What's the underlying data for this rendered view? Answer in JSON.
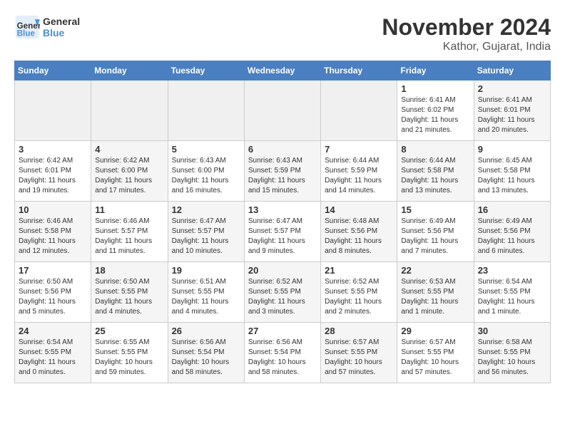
{
  "header": {
    "logo_line1": "General",
    "logo_line2": "Blue",
    "month": "November 2024",
    "location": "Kathor, Gujarat, India"
  },
  "weekdays": [
    "Sunday",
    "Monday",
    "Tuesday",
    "Wednesday",
    "Thursday",
    "Friday",
    "Saturday"
  ],
  "weeks": [
    [
      {
        "day": "",
        "info": ""
      },
      {
        "day": "",
        "info": ""
      },
      {
        "day": "",
        "info": ""
      },
      {
        "day": "",
        "info": ""
      },
      {
        "day": "",
        "info": ""
      },
      {
        "day": "1",
        "info": "Sunrise: 6:41 AM\nSunset: 6:02 PM\nDaylight: 11 hours\nand 21 minutes."
      },
      {
        "day": "2",
        "info": "Sunrise: 6:41 AM\nSunset: 6:01 PM\nDaylight: 11 hours\nand 20 minutes."
      }
    ],
    [
      {
        "day": "3",
        "info": "Sunrise: 6:42 AM\nSunset: 6:01 PM\nDaylight: 11 hours\nand 19 minutes."
      },
      {
        "day": "4",
        "info": "Sunrise: 6:42 AM\nSunset: 6:00 PM\nDaylight: 11 hours\nand 17 minutes."
      },
      {
        "day": "5",
        "info": "Sunrise: 6:43 AM\nSunset: 6:00 PM\nDaylight: 11 hours\nand 16 minutes."
      },
      {
        "day": "6",
        "info": "Sunrise: 6:43 AM\nSunset: 5:59 PM\nDaylight: 11 hours\nand 15 minutes."
      },
      {
        "day": "7",
        "info": "Sunrise: 6:44 AM\nSunset: 5:59 PM\nDaylight: 11 hours\nand 14 minutes."
      },
      {
        "day": "8",
        "info": "Sunrise: 6:44 AM\nSunset: 5:58 PM\nDaylight: 11 hours\nand 13 minutes."
      },
      {
        "day": "9",
        "info": "Sunrise: 6:45 AM\nSunset: 5:58 PM\nDaylight: 11 hours\nand 13 minutes."
      }
    ],
    [
      {
        "day": "10",
        "info": "Sunrise: 6:46 AM\nSunset: 5:58 PM\nDaylight: 11 hours\nand 12 minutes."
      },
      {
        "day": "11",
        "info": "Sunrise: 6:46 AM\nSunset: 5:57 PM\nDaylight: 11 hours\nand 11 minutes."
      },
      {
        "day": "12",
        "info": "Sunrise: 6:47 AM\nSunset: 5:57 PM\nDaylight: 11 hours\nand 10 minutes."
      },
      {
        "day": "13",
        "info": "Sunrise: 6:47 AM\nSunset: 5:57 PM\nDaylight: 11 hours\nand 9 minutes."
      },
      {
        "day": "14",
        "info": "Sunrise: 6:48 AM\nSunset: 5:56 PM\nDaylight: 11 hours\nand 8 minutes."
      },
      {
        "day": "15",
        "info": "Sunrise: 6:49 AM\nSunset: 5:56 PM\nDaylight: 11 hours\nand 7 minutes."
      },
      {
        "day": "16",
        "info": "Sunrise: 6:49 AM\nSunset: 5:56 PM\nDaylight: 11 hours\nand 6 minutes."
      }
    ],
    [
      {
        "day": "17",
        "info": "Sunrise: 6:50 AM\nSunset: 5:56 PM\nDaylight: 11 hours\nand 5 minutes."
      },
      {
        "day": "18",
        "info": "Sunrise: 6:50 AM\nSunset: 5:55 PM\nDaylight: 11 hours\nand 4 minutes."
      },
      {
        "day": "19",
        "info": "Sunrise: 6:51 AM\nSunset: 5:55 PM\nDaylight: 11 hours\nand 4 minutes."
      },
      {
        "day": "20",
        "info": "Sunrise: 6:52 AM\nSunset: 5:55 PM\nDaylight: 11 hours\nand 3 minutes."
      },
      {
        "day": "21",
        "info": "Sunrise: 6:52 AM\nSunset: 5:55 PM\nDaylight: 11 hours\nand 2 minutes."
      },
      {
        "day": "22",
        "info": "Sunrise: 6:53 AM\nSunset: 5:55 PM\nDaylight: 11 hours\nand 1 minute."
      },
      {
        "day": "23",
        "info": "Sunrise: 6:54 AM\nSunset: 5:55 PM\nDaylight: 11 hours\nand 1 minute."
      }
    ],
    [
      {
        "day": "24",
        "info": "Sunrise: 6:54 AM\nSunset: 5:55 PM\nDaylight: 11 hours\nand 0 minutes."
      },
      {
        "day": "25",
        "info": "Sunrise: 6:55 AM\nSunset: 5:55 PM\nDaylight: 10 hours\nand 59 minutes."
      },
      {
        "day": "26",
        "info": "Sunrise: 6:56 AM\nSunset: 5:54 PM\nDaylight: 10 hours\nand 58 minutes."
      },
      {
        "day": "27",
        "info": "Sunrise: 6:56 AM\nSunset: 5:54 PM\nDaylight: 10 hours\nand 58 minutes."
      },
      {
        "day": "28",
        "info": "Sunrise: 6:57 AM\nSunset: 5:55 PM\nDaylight: 10 hours\nand 57 minutes."
      },
      {
        "day": "29",
        "info": "Sunrise: 6:57 AM\nSunset: 5:55 PM\nDaylight: 10 hours\nand 57 minutes."
      },
      {
        "day": "30",
        "info": "Sunrise: 6:58 AM\nSunset: 5:55 PM\nDaylight: 10 hours\nand 56 minutes."
      }
    ]
  ]
}
